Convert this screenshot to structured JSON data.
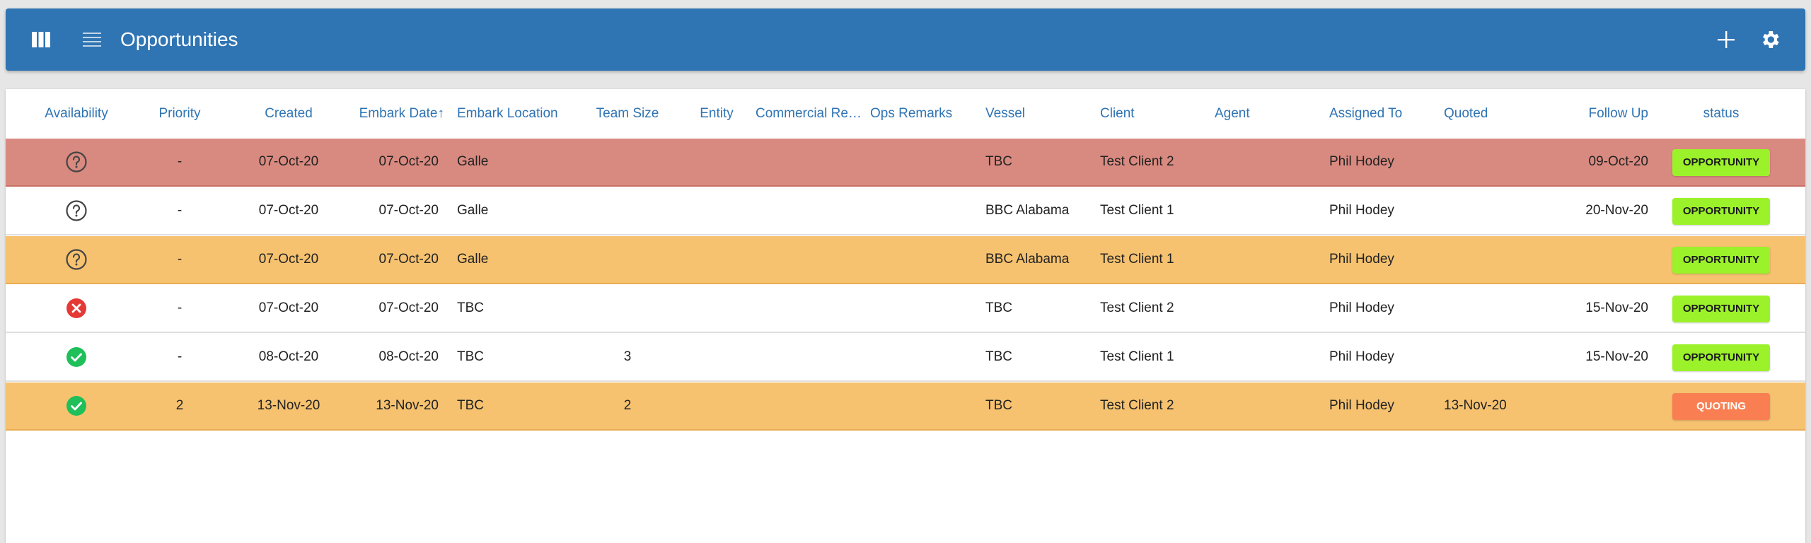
{
  "app": {
    "title": "Opportunities"
  },
  "columns": {
    "availability": "Availability",
    "priority": "Priority",
    "created": "Created",
    "embark_date": "Embark Date↑",
    "embark_location": "Embark Location",
    "team_size": "Team Size",
    "entity": "Entity",
    "commercial_remarks": "Commercial Remarks",
    "ops_remarks": "Ops Remarks",
    "vessel": "Vessel",
    "client": "Client",
    "agent": "Agent",
    "assigned_to": "Assigned To",
    "quoted": "Quoted",
    "follow_up": "Follow Up",
    "status": "status"
  },
  "colors": {
    "header_bar": "#2f74b3",
    "row_red": "#d98a80",
    "row_orange": "#f6c270",
    "badge_opportunity": "#9cf22a",
    "badge_quoting": "#f97f52",
    "avail_yes": "#1fbf5a",
    "avail_no": "#e53935"
  },
  "rows": [
    {
      "tone": "red",
      "availability": "unknown",
      "priority": "-",
      "created": "07-Oct-20",
      "embark_date": "07-Oct-20",
      "embark_location": "Galle",
      "team_size": "",
      "entity": "",
      "commercial_remarks": "",
      "ops_remarks": "",
      "vessel": "TBC",
      "client": "Test Client 2",
      "agent": "",
      "assigned_to": "Phil Hodey",
      "quoted": "",
      "follow_up": "09-Oct-20",
      "status": "OPPORTUNITY",
      "status_kind": "opp"
    },
    {
      "tone": "white",
      "availability": "unknown",
      "priority": "-",
      "created": "07-Oct-20",
      "embark_date": "07-Oct-20",
      "embark_location": "Galle",
      "team_size": "",
      "entity": "",
      "commercial_remarks": "",
      "ops_remarks": "",
      "vessel": "BBC Alabama",
      "client": "Test Client 1",
      "agent": "",
      "assigned_to": "Phil Hodey",
      "quoted": "",
      "follow_up": "20-Nov-20",
      "status": "OPPORTUNITY",
      "status_kind": "opp"
    },
    {
      "tone": "orange",
      "availability": "unknown",
      "priority": "-",
      "created": "07-Oct-20",
      "embark_date": "07-Oct-20",
      "embark_location": "Galle",
      "team_size": "",
      "entity": "",
      "commercial_remarks": "",
      "ops_remarks": "",
      "vessel": "BBC Alabama",
      "client": "Test Client 1",
      "agent": "",
      "assigned_to": "Phil Hodey",
      "quoted": "",
      "follow_up": "",
      "status": "OPPORTUNITY",
      "status_kind": "opp"
    },
    {
      "tone": "white",
      "availability": "unavailable",
      "priority": "-",
      "created": "07-Oct-20",
      "embark_date": "07-Oct-20",
      "embark_location": "TBC",
      "team_size": "",
      "entity": "",
      "commercial_remarks": "",
      "ops_remarks": "",
      "vessel": "TBC",
      "client": "Test Client 2",
      "agent": "",
      "assigned_to": "Phil Hodey",
      "quoted": "",
      "follow_up": "15-Nov-20",
      "status": "OPPORTUNITY",
      "status_kind": "opp"
    },
    {
      "tone": "white",
      "availability": "available",
      "priority": "-",
      "created": "08-Oct-20",
      "embark_date": "08-Oct-20",
      "embark_location": "TBC",
      "team_size": "3",
      "entity": "",
      "commercial_remarks": "",
      "ops_remarks": "",
      "vessel": "TBC",
      "client": "Test Client 1",
      "agent": "",
      "assigned_to": "Phil Hodey",
      "quoted": "",
      "follow_up": "15-Nov-20",
      "status": "OPPORTUNITY",
      "status_kind": "opp"
    },
    {
      "tone": "orange",
      "availability": "available",
      "priority": "2",
      "created": "13-Nov-20",
      "embark_date": "13-Nov-20",
      "embark_location": "TBC",
      "team_size": "2",
      "entity": "",
      "commercial_remarks": "",
      "ops_remarks": "",
      "vessel": "TBC",
      "client": "Test Client 2",
      "agent": "",
      "assigned_to": "Phil Hodey",
      "quoted": "13-Nov-20",
      "follow_up": "",
      "status": "QUOTING",
      "status_kind": "quo"
    }
  ]
}
